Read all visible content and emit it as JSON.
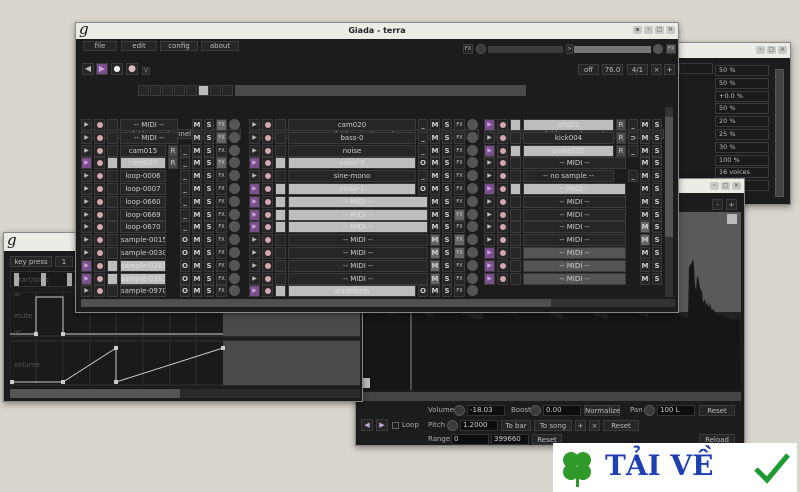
{
  "config_window": {
    "values": [
      "50 %",
      "50 %",
      "+0.0 %",
      "50 %",
      "20 %",
      "25 %",
      "30 %",
      "100 %",
      "16 voices",
      "nds"
    ]
  },
  "sample_editor": {
    "zoom_out": "-",
    "zoom_in": "+",
    "volume_label": "Volume",
    "volume": "-18.03",
    "boost_label": "Boost",
    "boost": "0.00",
    "normalize": "Normalize",
    "pan_label": "Pan",
    "pan": "100 L",
    "reset": "Reset",
    "pitch_label": "Pitch",
    "pitch": "1.2000",
    "to_bar": "To bar",
    "to_song": "To song",
    "plus": "+",
    "times": "×",
    "range_label": "Range",
    "range_start": "0",
    "range_end": "399660",
    "reload": "Reload",
    "loop": "Loop",
    "prev": "◀",
    "next": "▶"
  },
  "action_editor": {
    "logo": "g",
    "action_type": "key press",
    "channel": "1",
    "start_stop": "start/stop",
    "mute_on": "on",
    "mute": "mute",
    "mute_off": "off",
    "volume": "volume"
  },
  "main": {
    "title": "Giada - terra",
    "logo": "g",
    "menu": [
      "file",
      "edit",
      "config",
      "about"
    ],
    "fx_label": "FX",
    "arrow": ">",
    "transport": {
      "rewind": "◀",
      "play": "▶",
      "rec_actions": "●",
      "rec_input": "●",
      "metronome": "\\/"
    },
    "quantize": "off",
    "bpm": "76.0",
    "beats": "4/1",
    "clear": "×",
    "add": "+",
    "beat_active": 3,
    "add_channel": "Add new channel",
    "columns": [
      [
        {
          "name": "-- MIDI --",
          "mode": "",
          "fx": true
        },
        {
          "name": "-- MIDI --",
          "mode": "",
          "fx": true
        },
        {
          "name": "cam015",
          "r": true,
          "mode": "_"
        },
        {
          "name": "cam020",
          "lit": true,
          "play": true,
          "r": true,
          "mode": "_",
          "fx": true
        },
        {
          "name": "loop-0006",
          "mode": "_"
        },
        {
          "name": "loop-0007",
          "mode": "_"
        },
        {
          "name": "loop-0660",
          "mode": "_"
        },
        {
          "name": "loop-0669",
          "mode": "_"
        },
        {
          "name": "loop-0670",
          "mode": "_"
        },
        {
          "name": "sample-0015",
          "mode": "O"
        },
        {
          "name": "sample-0030",
          "mode": "O"
        },
        {
          "name": "sample-0361",
          "lit": true,
          "play": true,
          "mode": "O"
        },
        {
          "name": "sample-0362",
          "lit": true,
          "play": true,
          "mode": "O"
        },
        {
          "name": "sample-0970",
          "mode": "O"
        }
      ],
      [
        {
          "name": "cam020",
          "r": true,
          "mode": "_"
        },
        {
          "name": "bass-0",
          "mode": "_"
        },
        {
          "name": "noise",
          "mode": "_"
        },
        {
          "name": "noise-0",
          "lit": true,
          "play": true,
          "mode": "O"
        },
        {
          "name": "sine-mono",
          "mode": "_"
        },
        {
          "name": "noise-1",
          "lit": true,
          "play": true,
          "mode": "O"
        },
        {
          "name": "-- MIDI --",
          "lit": true,
          "play": true,
          "mode": ""
        },
        {
          "name": "-- MIDI --",
          "lit": true,
          "play": true,
          "mode": "",
          "fx": true
        },
        {
          "name": "-- MIDI --",
          "lit": true,
          "play": true,
          "mode": ""
        },
        {
          "name": "-- MIDI --",
          "mode": "",
          "m": true,
          "fx": true
        },
        {
          "name": "-- MIDI --",
          "mode": "",
          "m": true,
          "fx": true
        },
        {
          "name": "-- MIDI --",
          "mode": "",
          "m": true
        },
        {
          "name": "-- MIDI --",
          "mode": "",
          "m": true
        },
        {
          "name": "waveform",
          "lit": true,
          "play": true,
          "mode": "O"
        }
      ],
      [
        {
          "name": "sh001",
          "lit": true,
          "play": true,
          "r": true,
          "mode": "_"
        },
        {
          "name": "kick004",
          "r": true,
          "mode": "⊃"
        },
        {
          "name": "snare005",
          "lit": true,
          "play": true,
          "r": true,
          "mode": "_"
        },
        {
          "name": "-- MIDI --",
          "mode": ""
        },
        {
          "name": "-- no sample --",
          "mode": "_"
        },
        {
          "name": "-- MIDI --",
          "lit": true,
          "play": true,
          "mode": ""
        },
        {
          "name": "-- MIDI --",
          "mode": ""
        },
        {
          "name": "-- MIDI --",
          "mode": ""
        },
        {
          "name": "-- MIDI --",
          "mode": "",
          "m": true
        },
        {
          "name": "-- MIDI --",
          "mode": "",
          "m": true
        },
        {
          "name": "-- MIDI --",
          "mid": true,
          "play": true,
          "mode": ""
        },
        {
          "name": "-- MIDI --",
          "mid": true,
          "play": true,
          "mode": ""
        },
        {
          "name": "-- MIDI --",
          "mid": true,
          "play": true,
          "mode": ""
        }
      ]
    ]
  },
  "watermark": {
    "text": "TẢI VỀ"
  }
}
